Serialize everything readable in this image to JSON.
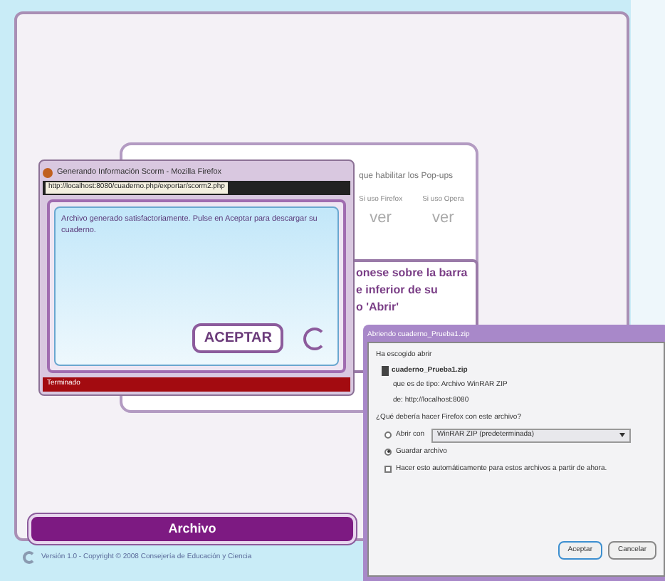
{
  "instructions_card": {
    "hint": "que habilitar los Pop-ups",
    "browsers": [
      {
        "label": "Si uso Firefox",
        "action": "ver"
      },
      {
        "label": "Si uso Opera",
        "action": "ver"
      }
    ],
    "steps": [
      "onese sobre la barra",
      "e inferior de su",
      "o 'Abrir'"
    ]
  },
  "popup_window": {
    "title": "Generando Información Scorm - Mozilla Firefox",
    "url": "http://localhost:8080/cuaderno.php/exportar/scorm2.php",
    "message": "Archivo generado satisfactoriamente. Pulse en Aceptar para descargar su cuaderno.",
    "button": "ACEPTAR",
    "status": "Terminado"
  },
  "download_dialog": {
    "title": "Abriendo cuaderno_Prueba1.zip",
    "intro": "Ha escogido abrir",
    "file_name": "cuaderno_Prueba1.zip",
    "file_type": "que es de tipo: Archivo WinRAR ZIP",
    "source": "de: http://localhost:8080",
    "question": "¿Qué debería hacer Firefox con este archivo?",
    "options": [
      {
        "label": "Abrir con",
        "selected": false,
        "kind": "select",
        "value": "WinRAR ZIP (predeterminada)"
      },
      {
        "label": "Guardar archivo",
        "selected": true,
        "kind": "plain"
      }
    ],
    "remember": {
      "label": "Hacer esto automáticamente para estos archivos a partir de ahora.",
      "checked": false
    },
    "buttons": [
      "Aceptar",
      "Cancelar"
    ]
  },
  "archive_button": "Archivo",
  "footer": "Versión 1.0 - Copyright © 2008 Consejería de Educación y Ciencia"
}
